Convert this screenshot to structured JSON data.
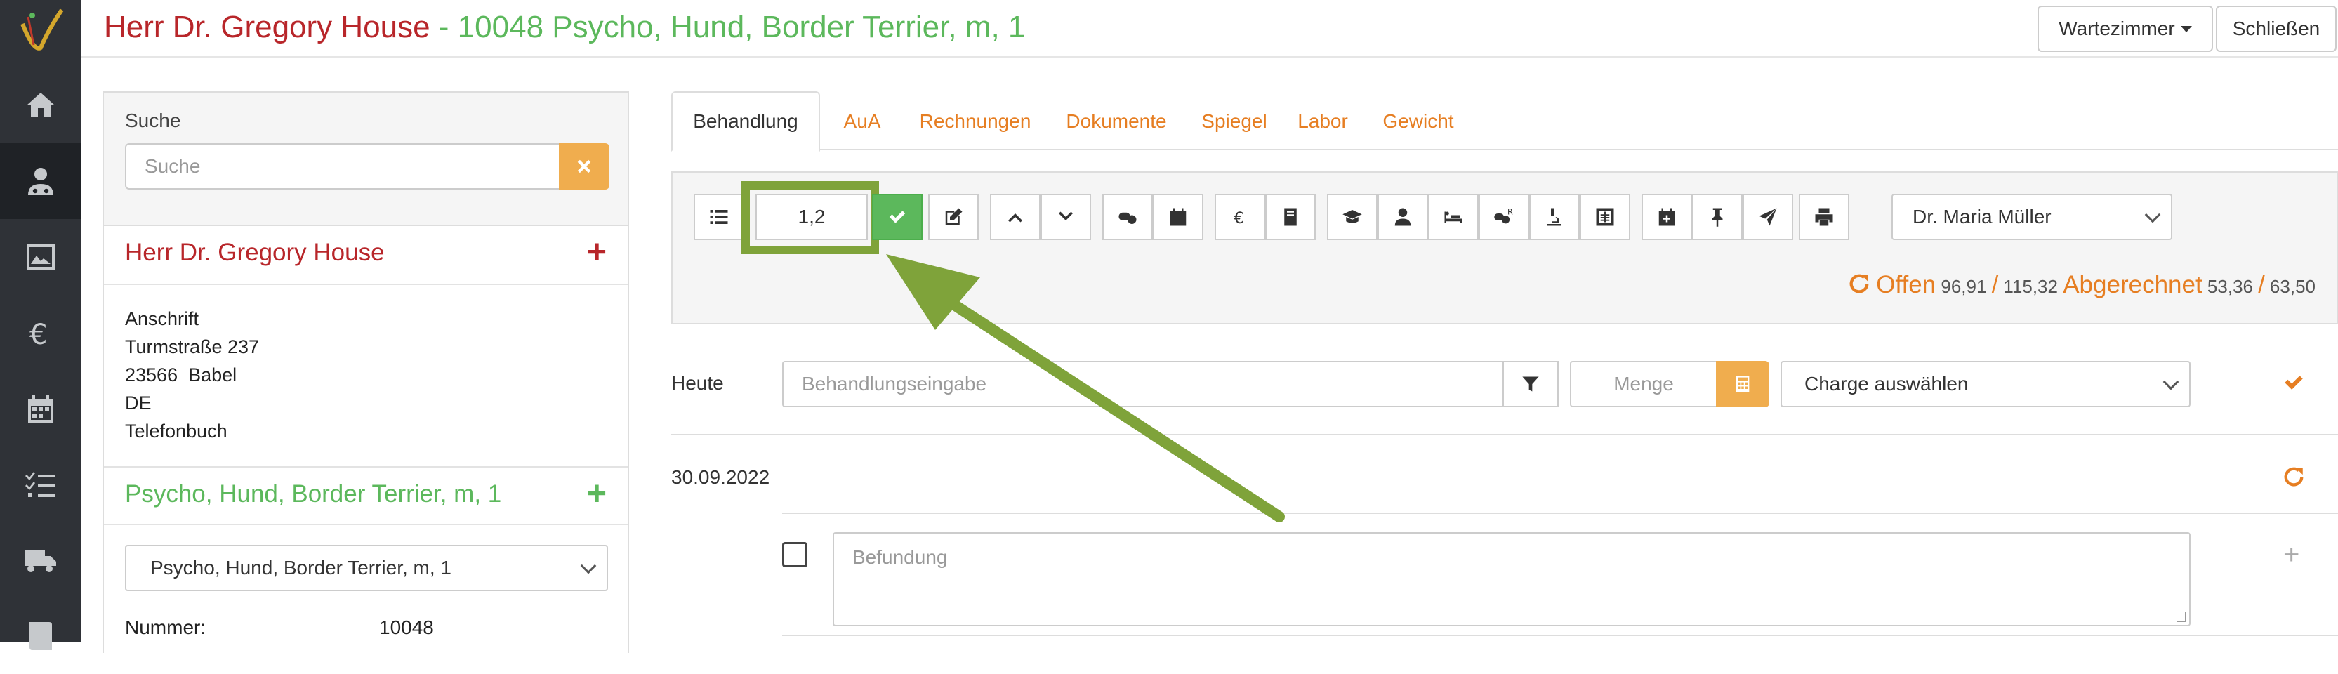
{
  "header": {
    "patient_owner": "Herr Dr. Gregory House",
    "patient_info": " - 10048 Psycho, Hund, Border Terrier, m, 1",
    "waiting_room_btn": "Wartezimmer",
    "close_btn": "Schließen"
  },
  "sidebar": {
    "items": [
      {
        "icon": "home-icon"
      },
      {
        "icon": "patients-icon",
        "active": true
      },
      {
        "icon": "image-icon"
      },
      {
        "icon": "euro-icon"
      },
      {
        "icon": "calendar-icon"
      },
      {
        "icon": "checklist-icon"
      },
      {
        "icon": "truck-icon"
      },
      {
        "icon": "book-icon"
      }
    ]
  },
  "left": {
    "search_label": "Suche",
    "search_placeholder": "Suche",
    "owner_name": "Herr Dr. Gregory House",
    "address_lines": [
      "Anschrift",
      "Turmstraße 237",
      "23566  Babel",
      "DE",
      "Telefonbuch"
    ],
    "animal_title": "Psycho, Hund, Border Terrier, m, 1",
    "animal_select": "Psycho, Hund, Border Terrier, m, 1",
    "number_label": "Nummer:",
    "number_value": "10048"
  },
  "tabs": [
    "Behandlung",
    "AuA",
    "Rechnungen",
    "Dokumente",
    "Spiegel",
    "Labor",
    "Gewicht"
  ],
  "toolbar": {
    "quantity_value": "1,2",
    "doctor_select": "Dr. Maria Müller"
  },
  "status": {
    "open_label": "Offen",
    "open_value1": "96,91",
    "open_value2": "115,32",
    "billed_label": "Abgerechnet",
    "billed_value1": "53,36",
    "billed_value2": "63,50",
    "separator": "/"
  },
  "entry": {
    "today_label": "Heute",
    "treatment_placeholder": "Behandlungseingabe",
    "quantity_placeholder": "Menge",
    "charge_select": "Charge auswählen"
  },
  "record": {
    "date": "30.09.2022",
    "finding_placeholder": "Befundung"
  },
  "colors": {
    "owner_red": "#b8262a",
    "patient_green": "#5cb85c",
    "accent_orange": "#e67e22",
    "highlight_green": "#7fa33a"
  }
}
